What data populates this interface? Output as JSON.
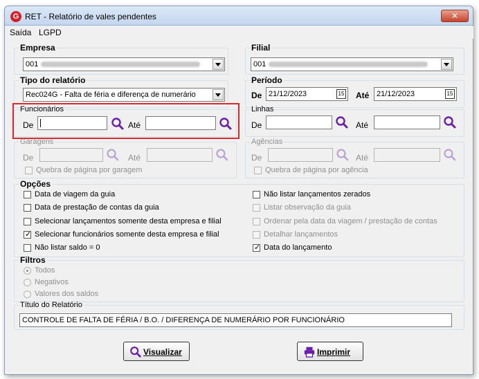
{
  "window": {
    "title": "RET - Relatório de vales pendentes",
    "app_icon": "G",
    "close": "✕"
  },
  "menu": {
    "items": [
      "Saída",
      "LGPD"
    ]
  },
  "empresa": {
    "legend": "Empresa",
    "value": "001"
  },
  "filial": {
    "legend": "Filial",
    "value": "001"
  },
  "tipo": {
    "legend": "Tipo do relatório",
    "value": "Rec024G - Falta de féria e diferença de numerário"
  },
  "periodo": {
    "legend": "Período",
    "de_label": "De",
    "de_value": "21/12/2023",
    "ate_label": "Até",
    "ate_value": "21/12/2023",
    "cal_icon": "15"
  },
  "funcionarios": {
    "legend": "Funcionários",
    "de_label": "De",
    "ate_label": "Até"
  },
  "linhas": {
    "legend": "Linhas",
    "de_label": "De",
    "ate_label": "Até"
  },
  "garagens": {
    "legend": "Garagens",
    "de_label": "De",
    "ate_label": "Até",
    "quebra": "Quebra de página por garagem"
  },
  "agencias": {
    "legend": "Agências",
    "de_label": "De",
    "ate_label": "Até",
    "quebra": "Quebra de página por agência"
  },
  "opcoes": {
    "legend": "Opções",
    "left": [
      {
        "label": "Data de viagem da guia",
        "checked": false,
        "enabled": true
      },
      {
        "label": "Data de prestação de contas da guia",
        "checked": false,
        "enabled": true
      },
      {
        "label": "Selecionar lançamentos somente desta empresa e filial",
        "checked": false,
        "enabled": true
      },
      {
        "label": "Selecionar funcionários somente desta empresa e filial",
        "checked": true,
        "enabled": true
      },
      {
        "label": "Não listar saldo = 0",
        "checked": false,
        "enabled": true
      }
    ],
    "right": [
      {
        "label": "Não listar lançamentos zerados",
        "checked": false,
        "enabled": true
      },
      {
        "label": "Listar observação da guia",
        "checked": false,
        "enabled": false
      },
      {
        "label": "Ordenar pela data da viagem / prestação de contas",
        "checked": false,
        "enabled": false
      },
      {
        "label": "Detalhar lançamentos",
        "checked": false,
        "enabled": false
      },
      {
        "label": "Data do lançamento",
        "checked": true,
        "enabled": true
      }
    ]
  },
  "filtros": {
    "legend": "Filtros",
    "options": [
      "Todos",
      "Negativos",
      "Valores dos saldos"
    ],
    "selected": "Todos"
  },
  "titulo": {
    "legend": "Título do Relatório",
    "value": "CONTROLE DE FALTA DE FÉRIA / B.O. / DIFERENÇA DE NUMERÁRIO POR FUNCIONÁRIO"
  },
  "buttons": {
    "visualizar": "Visualizar",
    "imprimir": "Imprimir"
  },
  "colors": {
    "accent_purple": "#6a1fa8",
    "highlight_red": "#d92b2b",
    "brand_red": "#d71f26"
  }
}
